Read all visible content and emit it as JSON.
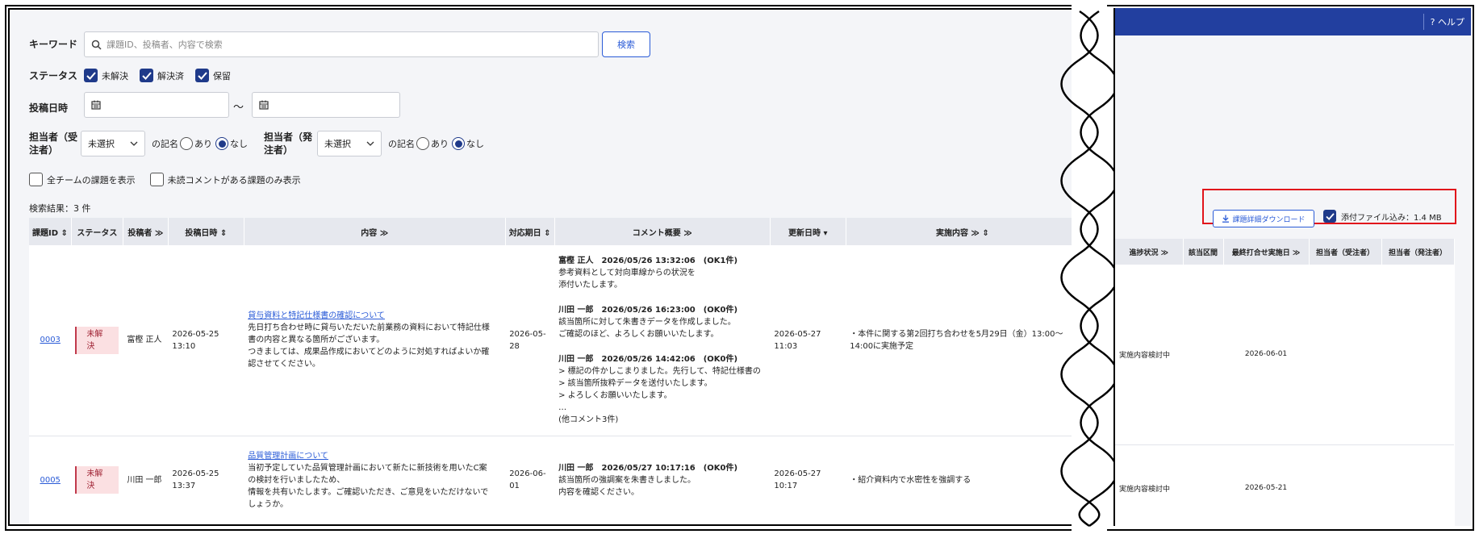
{
  "search": {
    "keyword_label": "キーワード",
    "keyword_placeholder": "課題ID、投稿者、内容で検索",
    "search_button": "検索",
    "status_label": "ステータス",
    "status_options": [
      {
        "label": "未解決",
        "checked": true
      },
      {
        "label": "解決済",
        "checked": true
      },
      {
        "label": "保留",
        "checked": true
      }
    ],
    "posted_date_label": "投稿日時",
    "date_separator": "〜",
    "assignee_receiver_label": "担当者（受注者）",
    "assignee_orderer_label": "担当者（発注者）",
    "select_value": "未選択",
    "mention_label": "の記名",
    "radio_yes": "あり",
    "radio_no": "なし",
    "all_teams_label": "全チームの課題を表示",
    "unread_only_label": "未読コメントがある課題のみ表示",
    "result_count": "検索結果：3 件"
  },
  "table": {
    "headers": [
      "課題ID",
      "ステータス",
      "投稿者 ≫",
      "投稿日時",
      "内容 ≫",
      "対応期日",
      "コメント概要 ≫",
      "更新日時",
      "実施内容 ≫"
    ],
    "rows": [
      {
        "id": "0003",
        "status": "未解決",
        "poster": "富樫 正人",
        "posted": "2026-05-25 13:10",
        "content_title": "貸与資料と特記仕様書の確認について",
        "content_body": [
          "先日打ち合わせ時に貸与いただいた前業務の資料において特記仕様",
          "書の内容と異なる箇所がございます。",
          "つきましては、成果品作成においてどのように対処すればよいか確",
          "認させてください。"
        ],
        "due": "2026-05-28",
        "comments": [
          {
            "head": "富樫 正人　2026/05/26 13:32:06　(OK1件)",
            "lines": [
              "参考資料として対向車線からの状況を",
              "添付いたします。"
            ]
          },
          {
            "head": "川田 一郎　2026/05/26 16:23:00　(OK0件)",
            "lines": [
              "該当箇所に対して朱書きデータを作成しました。",
              "ご確認のほど、よろしくお願いいたします。"
            ]
          },
          {
            "head": "川田 一郎　2026/05/26 14:42:06　(OK0件)",
            "lines": [
              "> 標記の件かしこまりました。先行して、特記仕様書の",
              "> 該当箇所抜粋データを送付いたします。",
              "> よろしくお願いいたします。",
              "…",
              "(他コメント3件)"
            ]
          }
        ],
        "updated": "2026-05-27 11:03",
        "action": [
          "・本件に関する第2回打ち合わせを5月29日（金）13:00～",
          "14:00に実施予定"
        ],
        "progress": "実施内容検討中",
        "last_meeting": "2026-06-01"
      },
      {
        "id": "0005",
        "status": "未解決",
        "poster": "川田 一郎",
        "posted": "2026-05-25 13:37",
        "content_title": "品質管理計画について",
        "content_body": [
          "当初予定していた品質管理計画において新たに新技術を用いたC案",
          "の検討を行いましたため、",
          "情報を共有いたします。ご確認いただき、ご意見をいただけないで",
          "しょうか。"
        ],
        "due": "2026-06-01",
        "comments": [
          {
            "head": "川田 一郎　2026/05/27 10:17:16　(OK0件)",
            "lines": [
              "該当箇所の強調案を朱書きしました。",
              "内容を確認ください。"
            ]
          }
        ],
        "updated": "2026-05-27 10:17",
        "action": [
          "・紹介資料内で水密性を強調する"
        ],
        "progress": "実施内容検討中",
        "last_meeting": "2026-05-21"
      }
    ]
  },
  "right": {
    "help_label": "? ヘルプ",
    "download_button": "課題詳細ダウンロード",
    "attach_label": "添付ファイル込み：1.4 MB",
    "attach_checked": true,
    "headers": [
      "進捗状況 ≫",
      "該当区間",
      "最終打合せ実施日 ≫",
      "担当者（受注者）",
      "担当者（発注者）"
    ]
  }
}
